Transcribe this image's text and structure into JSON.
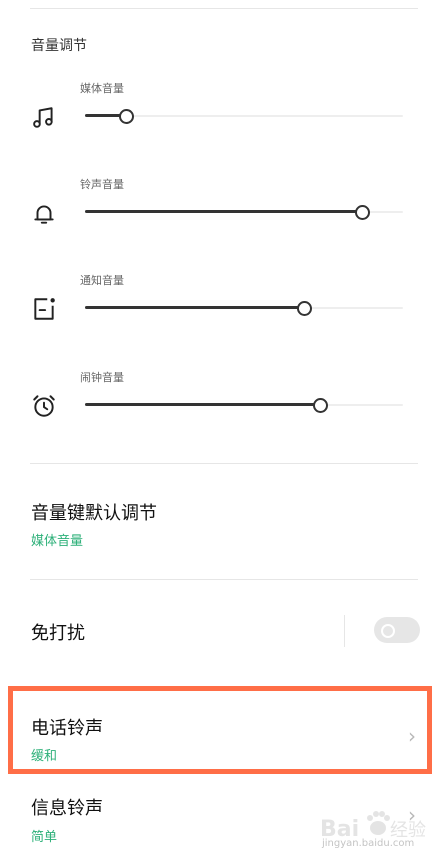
{
  "volume_section": {
    "title": "音量调节",
    "sliders": [
      {
        "id": "media",
        "label": "媒体音量",
        "icon": "music-note-icon",
        "level_percent": 13
      },
      {
        "id": "ringtone",
        "label": "铃声音量",
        "icon": "bell-icon",
        "level_percent": 87
      },
      {
        "id": "notification",
        "label": "通知音量",
        "icon": "notification-icon",
        "level_percent": 69
      },
      {
        "id": "alarm",
        "label": "闹钟音量",
        "icon": "alarm-clock-icon",
        "level_percent": 74
      }
    ]
  },
  "volume_key": {
    "title": "音量键默认调节",
    "value": "媒体音量"
  },
  "do_not_disturb": {
    "title": "免打扰",
    "enabled": false
  },
  "phone_ringtone": {
    "title": "电话铃声",
    "value": "缓和"
  },
  "message_ringtone": {
    "title": "信息铃声",
    "value": "简单"
  },
  "watermark": {
    "text": "jingyan.baidu.com",
    "icon": "baidu-paw-logo"
  },
  "colors": {
    "accent_green": "#2db079",
    "highlight_orange": "#ff6e47",
    "slider_dark": "#333333"
  }
}
